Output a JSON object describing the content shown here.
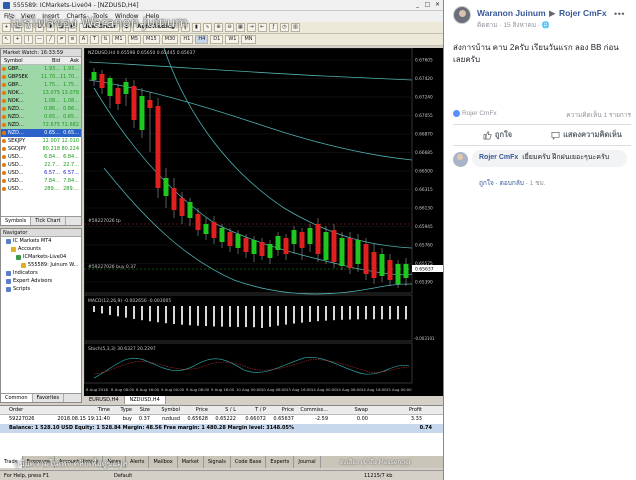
{
  "mt4": {
    "window_title": "555589: ICMarkets-Live04 - [NZDUSD,H4]",
    "overlay_caption": "โปรไฟล์ของ Waranon Juinum",
    "menu": [
      "File",
      "View",
      "Insert",
      "Charts",
      "Tools",
      "Window",
      "Help"
    ],
    "toolbar": {
      "new_order": "New Order",
      "auto_trading": "AutoTrading",
      "timeframes": [
        "M1",
        "M5",
        "M15",
        "M30",
        "H1",
        "H4",
        "D1",
        "W1",
        "MN"
      ]
    },
    "market_watch": {
      "title": "Market Watch: 16:33:59",
      "columns": [
        "Symbol",
        "Bid",
        "Ask"
      ],
      "rows": [
        {
          "symbol": "GBP...",
          "bid": "1.93...",
          "ask": "1.93...",
          "style": "hl"
        },
        {
          "symbol": "GBPSEK",
          "bid": "11.70...",
          "ask": "11.70...",
          "style": "hl"
        },
        {
          "symbol": "GBP...",
          "bid": "1.75...",
          "ask": "1.75...",
          "style": "hl"
        },
        {
          "symbol": "NOK...",
          "bid": "13.075",
          "ask": "13.078",
          "style": "hl"
        },
        {
          "symbol": "NOK...",
          "bid": "1.08...",
          "ask": "1.08...",
          "style": "hl"
        },
        {
          "symbol": "NZD...",
          "bid": "0.86...",
          "ask": "0.86...",
          "style": "hl"
        },
        {
          "symbol": "NZD...",
          "bid": "0.65...",
          "ask": "0.65...",
          "style": "hl"
        },
        {
          "symbol": "NZD...",
          "bid": "72.675",
          "ask": "72.682",
          "style": "hl"
        },
        {
          "symbol": "NZD...",
          "bid": "0.65...",
          "ask": "0.65...",
          "style": "sel"
        },
        {
          "symbol": "SEKJPY",
          "bid": "12.007",
          "ask": "12.010",
          "style": ""
        },
        {
          "symbol": "SGDJPY",
          "bid": "80.218",
          "ask": "80.224",
          "style": ""
        },
        {
          "symbol": "USD...",
          "bid": "6.84...",
          "ask": "6.84...",
          "style": ""
        },
        {
          "symbol": "USD...",
          "bid": "22.7...",
          "ask": "22.7...",
          "style": ""
        },
        {
          "symbol": "USD...",
          "bid": "6.57...",
          "ask": "6.57...",
          "style": "dn"
        },
        {
          "symbol": "USD...",
          "bid": "7.84...",
          "ask": "7.84...",
          "style": ""
        },
        {
          "symbol": "USD...",
          "bid": "289....",
          "ask": "289....",
          "style": ""
        }
      ],
      "tabs": [
        "Symbols",
        "Tick Chart"
      ]
    },
    "navigator": {
      "title": "Navigator",
      "items": [
        {
          "label": "IC Markets MT4",
          "indent": 1
        },
        {
          "label": "Accounts",
          "indent": 2
        },
        {
          "label": "ICMarkets-Live04",
          "indent": 3
        },
        {
          "label": "555589: Juinum W...",
          "indent": 4
        },
        {
          "label": "Indicators",
          "indent": 1
        },
        {
          "label": "Expert Advisors",
          "indent": 1
        },
        {
          "label": "Scripts",
          "indent": 1
        }
      ],
      "tabs": [
        "Common",
        "Favorites"
      ]
    },
    "chart": {
      "title": "NZDUSD,H4",
      "ohlc": "0.65598 0.65650 0.65445 0.65637",
      "line_label_1": "#59227026 tp",
      "line_label_2": "#59227026 buy 0.37",
      "price_tag": "0.65637",
      "macd_label": "MACD(12,26,9) -0.002656 -0.003005",
      "stoch_label": "Stoch(5,3,3) 30.6327 20.2297",
      "osc_right_value": "-0.003101",
      "price_levels": [
        "0.67605",
        "0.67420",
        "0.67240",
        "0.67055",
        "0.66870",
        "0.66685",
        "0.66500",
        "0.66315",
        "0.66130",
        "0.65945",
        "0.65760",
        "0.65575",
        "0.65390"
      ],
      "date_labels": [
        "8 Aug 2018",
        "8 Aug 08:00",
        "8 Aug 16:00",
        "9 Aug 00:00",
        "9 Aug 08:00",
        "9 Aug 16:00",
        "10 Aug 00:00",
        "10 Aug 08:00",
        "13 Aug 16:00",
        "14 Aug 00:00",
        "14 Aug 08:00",
        "14 Aug 16:00",
        "15 Aug 00:00"
      ]
    },
    "chart_tabs": [
      "EURUSD,H4",
      "NZDUSD,H4"
    ],
    "terminal": {
      "columns": [
        "Order",
        "Time",
        "Type",
        "Size",
        "Symbol",
        "Price",
        "S / L",
        "T / P",
        "Price",
        "Commiss...",
        "Swap",
        "Profit"
      ],
      "order": {
        "order": "59227026",
        "time": "2018.08.15 19:11:40",
        "type": "buy",
        "size": "0.37",
        "symbol": "nzdusd",
        "price": "0.65628",
        "sl": "0.65222",
        "tp": "0.66072",
        "price_now": "0.65637",
        "commission": "-2.59",
        "swap": "0.00",
        "profit": "3.33"
      },
      "balance_line": "Balance: 1 528.10 USD  Equity: 1 528.84  Margin: 48.56  Free margin: 1 480.28  Margin level: 3148.05%",
      "balance_profit": "0.74",
      "tabs": [
        "Trade",
        "Exposure",
        "Account History",
        "News",
        "Alerts",
        "Mailbox",
        "Market",
        "Signals",
        "Code Base",
        "Experts",
        "Journal"
      ],
      "overlay_left": "ดูข้อความในเพจ คลิกเพื่อดูข้อมูล",
      "overlay_right": "ส่งเสียง  เข้าถึง Messenger"
    },
    "status": {
      "left": "For Help, press F1",
      "middle": "Default",
      "right": "11215/7 kb"
    }
  },
  "facebook": {
    "author": "Waranon Juinum",
    "arrow": "▶",
    "group": "Rojer CmFx",
    "meta": "ติดตาม · 15 สิงหาคม · 🌐",
    "more": "•••",
    "post_text": "ส่งการบ้าน คาบ 2ครับ เรียนวันแรก ลอง BB ก่อน เลยครับ",
    "like_source": "Rojer CmFx",
    "comments_count": "ความคิดเห็น 1 รายการ",
    "like_button": "ถูกใจ",
    "comment_button": "แสดงความคิดเห็น",
    "comment": {
      "author": "Rojer CmFx",
      "text": "เยี่ยมครับ ฝึกฝนเยอะๆนะครับ",
      "actions": [
        "ถูกใจ",
        "ตอบกลับ"
      ],
      "time": "1 ชม."
    }
  }
}
